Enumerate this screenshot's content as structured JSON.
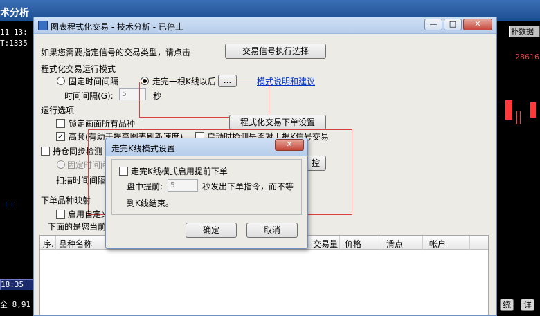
{
  "background": {
    "app_title": "术分析",
    "left_lines": [
      "11 13:",
      "T:1335"
    ],
    "time_badge": "18:35",
    "bottom_value": "全 8,91",
    "right_button": "补数据",
    "right_value": "28616",
    "right_bottom_buttons": [
      "统",
      "详"
    ]
  },
  "window": {
    "title": "图表程式化交易 - 技术分析 - 已停止",
    "buttons": {
      "minimize": "—",
      "restore": "□",
      "close": "✕"
    },
    "signal_prompt": "如果您需要指定信号的交易类型，请点击",
    "signal_button": "交易信号执行选择",
    "mode_group": "程式化交易运行模式",
    "mode_fixed": "固定时间间隔",
    "mode_bar": "走完一根K线以后",
    "mode_bar_more": "...",
    "mode_link": "模式说明和建议",
    "interval_label": "时间间隔(G):",
    "interval_value": "5",
    "interval_unit": "秒",
    "run_group": "运行选项",
    "lock_all": "锁定画面所有品种",
    "order_settings_button": "程式化交易下单设置",
    "high_freq": "高频(有助于提高图表刷新速度)",
    "auto_check": "启动时检测是否对上根K信号交易",
    "sync_check": "持仓同步检测",
    "sync_fixed": "固定时间间",
    "sync_button": "控",
    "scan_interval": "扫描时间间隔",
    "mapping_group": "下单品种映射",
    "custom_enable": "启用自定义",
    "current_info": "下面的是您当前",
    "table_columns": [
      "序.",
      "品种名称",
      "交易量",
      "价格",
      "滑点",
      "帐户"
    ]
  },
  "dialog": {
    "title": "走完K线模式设置",
    "early_order": "走完K线模式启用提前下单",
    "advance_label": "盘中提前:",
    "advance_value": "5",
    "advance_suffix": "秒发出下单指令，而不等",
    "advance_suffix2": "到K线结束。",
    "ok": "确定",
    "cancel": "取消",
    "close": "✕"
  }
}
